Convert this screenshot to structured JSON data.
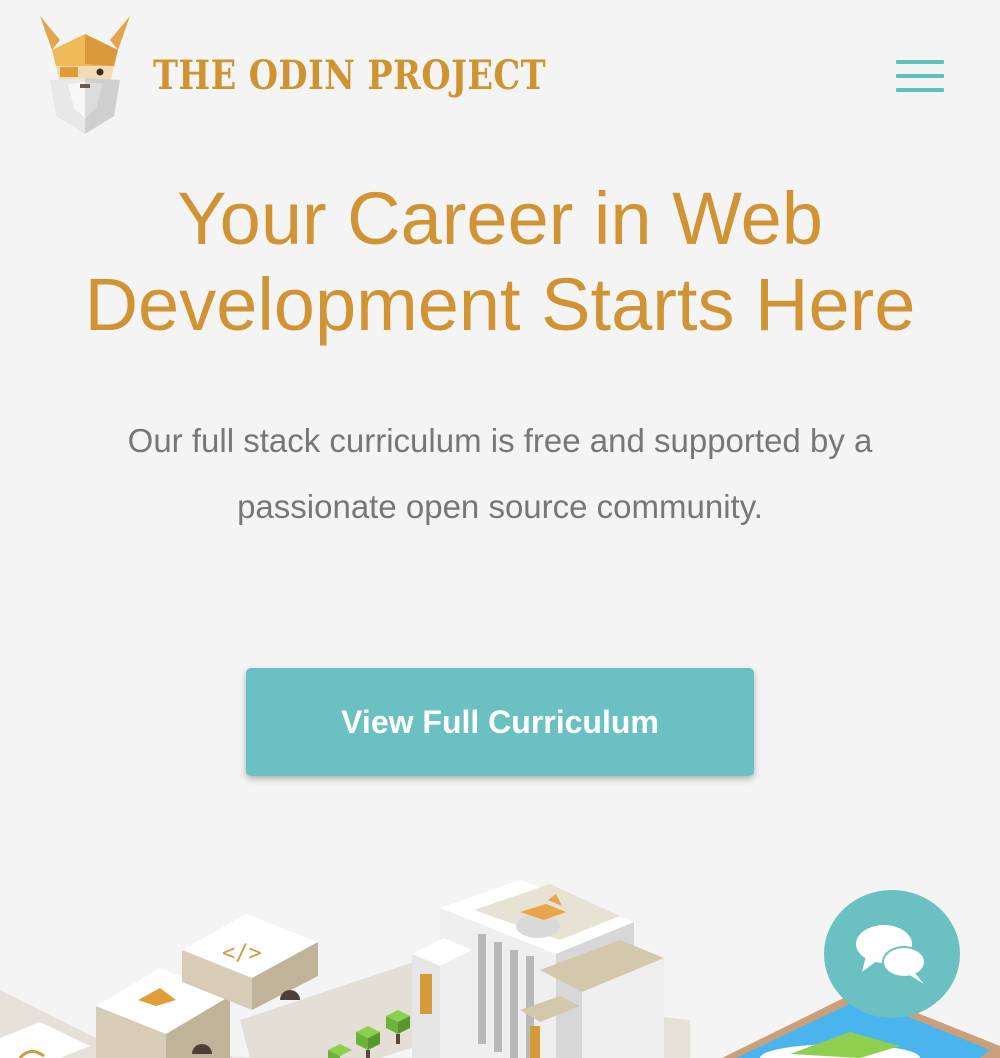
{
  "header": {
    "brand_name": "THE ODIN PROJECT",
    "logo_icon": "odin-viking-head-icon",
    "menu_icon": "hamburger-menu-icon"
  },
  "hero": {
    "title_line1": "Your Career in Web",
    "title_line2": "Development Starts Here",
    "subtitle_line1": "Our full stack curriculum is free and supported by a",
    "subtitle_line2": "passionate open source community.",
    "cta_label": "View Full Curriculum"
  },
  "illustration": {
    "name": "isometric-city-illustration"
  },
  "chat_widget": {
    "icon": "chat-bubbles-icon"
  },
  "colors": {
    "brand_gold": "#d09435",
    "accent_teal": "#6bc0c1",
    "body_text": "#777777",
    "background": "#f4f4f4"
  }
}
